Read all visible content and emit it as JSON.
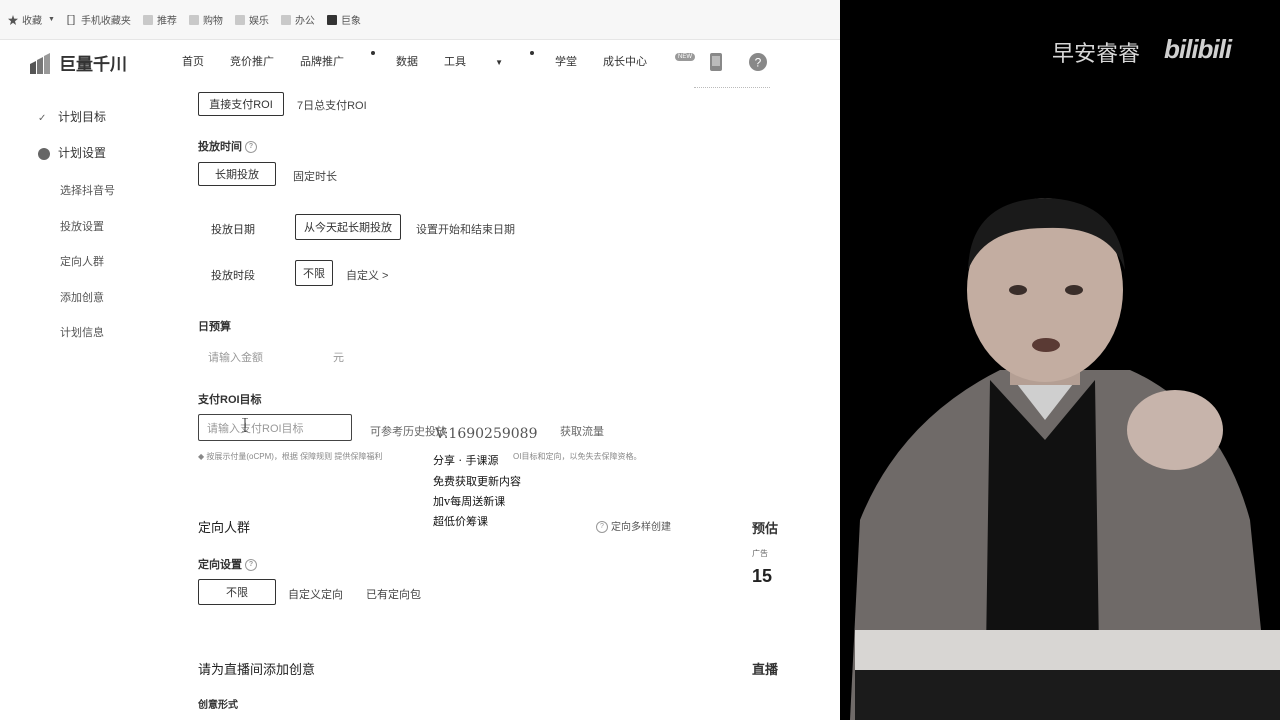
{
  "browser": {
    "bookmarks": [
      {
        "label": "收藏",
        "icon": "star-icon"
      },
      {
        "label": "手机收藏夹",
        "icon": "phone-icon"
      },
      {
        "label": "推荐",
        "icon": "folder-icon"
      },
      {
        "label": "购物",
        "icon": "folder-icon"
      },
      {
        "label": "娱乐",
        "icon": "folder-icon"
      },
      {
        "label": "办公",
        "icon": "folder-icon"
      },
      {
        "label": "巨象",
        "icon": "folder-icon"
      }
    ]
  },
  "header": {
    "logo_text": "巨量千川",
    "nav": [
      "首页",
      "竞价推广",
      "品牌推广",
      "数据",
      "工具",
      "学堂",
      "成长中心"
    ],
    "new_badge": "NEW"
  },
  "sidebar": {
    "steps": [
      {
        "label": "计划目标",
        "icon": "check-icon"
      },
      {
        "label": "计划设置",
        "icon": "current-step-icon"
      }
    ],
    "sub_items": [
      "选择抖音号",
      "投放设置",
      "定向人群",
      "添加创意",
      "计划信息"
    ]
  },
  "form": {
    "roi_tabs": [
      "直接支付ROI",
      "7日总支付ROI"
    ],
    "delivery_time_label": "投放时间",
    "delivery_time_options": [
      "长期投放",
      "固定时长"
    ],
    "delivery_date_label": "投放日期",
    "delivery_date_options": [
      "从今天起长期投放",
      "设置开始和结束日期"
    ],
    "delivery_period_label": "投放时段",
    "delivery_period_options": [
      "不限",
      "自定义 >"
    ],
    "daily_budget_label": "日预算",
    "daily_budget_placeholder": "请输入金额",
    "daily_budget_unit": "元",
    "roi_target_label": "支付ROI目标",
    "roi_target_placeholder": "请输入支付ROI目标",
    "roi_hint": "可参考历史投放",
    "roi_hint_tail": "获取流量",
    "roi_note": "按展示付量(oCPM)，根据 保障规则 提供保障福利",
    "roi_note_tail": "OI目标和定向，以免失去保障资格。",
    "targeting_title": "定向人群",
    "targeting_link": "定向多样创建",
    "targeting_setting_label": "定向设置",
    "targeting_options": [
      "不限",
      "自定义定向",
      "已有定向包"
    ],
    "creative_title": "请为直播间添加创意",
    "creative_form_label": "创意形式",
    "right_panel": {
      "title": "预估",
      "sub": "广告",
      "number": "15",
      "bottom": "直播"
    }
  },
  "overlay_text": {
    "contact": "V:1690259089",
    "lines": [
      "分享 · 手课源",
      "免费获取更新内容",
      "加v每周送新课",
      "超低价筹课"
    ]
  },
  "video": {
    "watermark_text": "早安睿睿",
    "watermark_logo": "bilibili"
  }
}
